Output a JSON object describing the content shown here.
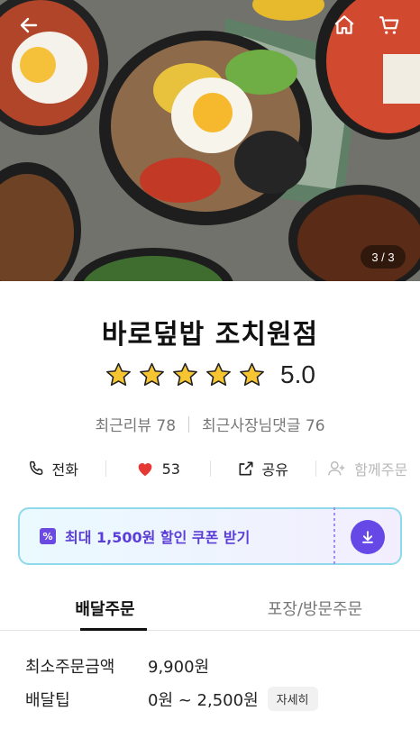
{
  "header": {
    "back_icon": "back-arrow-icon",
    "home_icon": "home-icon",
    "cart_icon": "cart-icon",
    "page_indicator": "3 / 3"
  },
  "store": {
    "name": "바로덮밥 조치원점",
    "rating": "5.0",
    "stars": 5,
    "recent_reviews_label": "최근리뷰 78",
    "recent_owner_replies_label": "최근사장님댓글 76"
  },
  "actions": {
    "call_label": "전화",
    "like_count": "53",
    "share_label": "공유",
    "group_order_label": "함께주문"
  },
  "coupon": {
    "label": "최대 1,500원 할인 쿠폰 받기",
    "accent": "#6548e6"
  },
  "tabs": [
    {
      "label": "배달주문",
      "active": true
    },
    {
      "label": "포장/방문주문",
      "active": false
    }
  ],
  "info": {
    "min_order_label": "최소주문금액",
    "min_order_value": "9,900원",
    "delivery_tip_label": "배달팁",
    "delivery_tip_value": "0원 ~ 2,500원",
    "detail_button": "자세히"
  }
}
